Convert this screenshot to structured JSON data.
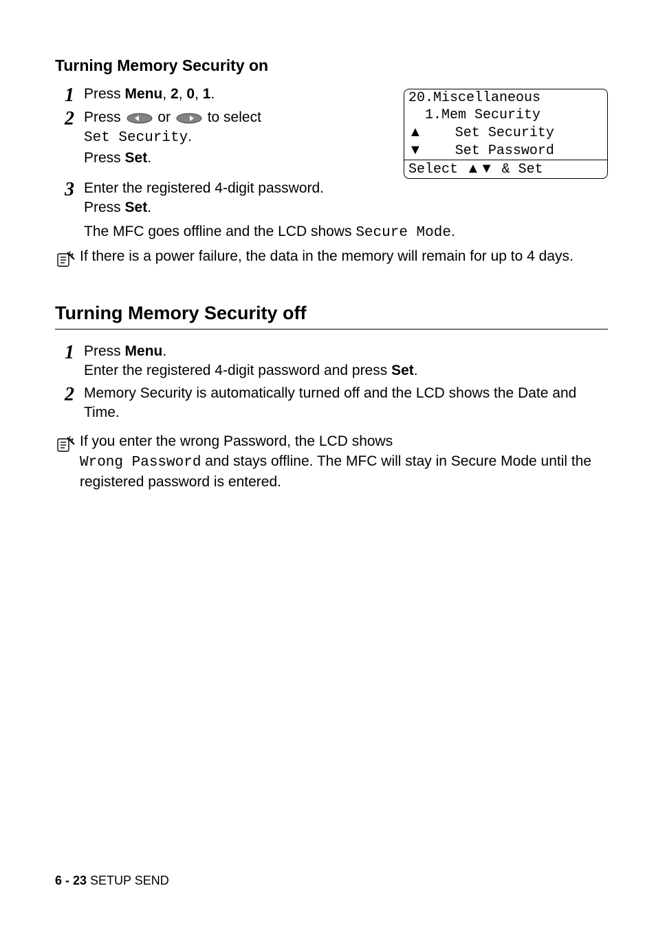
{
  "section_on": {
    "heading": "Turning Memory Security on",
    "steps": [
      {
        "num": "1",
        "pre": "Press ",
        "keys": [
          "Menu",
          "2",
          "0",
          "1"
        ],
        "sep": ", ",
        "post": "."
      },
      {
        "num": "2",
        "a_pre": "Press ",
        "a_mid": " or ",
        "a_post": " to select",
        "lcd_cmd": "Set Security",
        "b_pre": "Press ",
        "b_key": "Set",
        "b_post": "."
      },
      {
        "num": "3",
        "a": "Enter the registered 4-digit password.",
        "b_pre": "Press ",
        "b_key": "Set",
        "b_post": ".",
        "c_pre": "The MFC goes offline and the LCD shows ",
        "c_mono": "Secure Mode",
        "c_post": "."
      }
    ],
    "lcd": {
      "l1": "20.Miscellaneous",
      "l2": "  1.Mem Security",
      "l3a": "▲",
      "l3b": "    Set Security",
      "l4a": "▼",
      "l4b": "    Set Password",
      "l5_pre": "Select ",
      "l5_arrows": "▲▼",
      "l5_post": " & Set"
    },
    "note": "If there is a power failure, the data in the memory will remain for up to 4 days."
  },
  "section_off": {
    "heading": "Turning Memory Security off",
    "steps": [
      {
        "num": "1",
        "a_pre": "Press ",
        "a_key": "Menu",
        "a_post": ".",
        "b_pre": "Enter the registered 4-digit password and press ",
        "b_key": "Set",
        "b_post": "."
      },
      {
        "num": "2",
        "text": "Memory Security is automatically turned off and the LCD shows the Date and Time."
      }
    ],
    "note": {
      "a": "If you enter the wrong Password, the LCD shows",
      "b_mono": "Wrong Password",
      "b_rest": " and stays offline. The MFC will stay in Secure Mode until the registered password is entered."
    }
  },
  "footer": {
    "page": "6 - 23",
    "title": "   SETUP SEND"
  }
}
